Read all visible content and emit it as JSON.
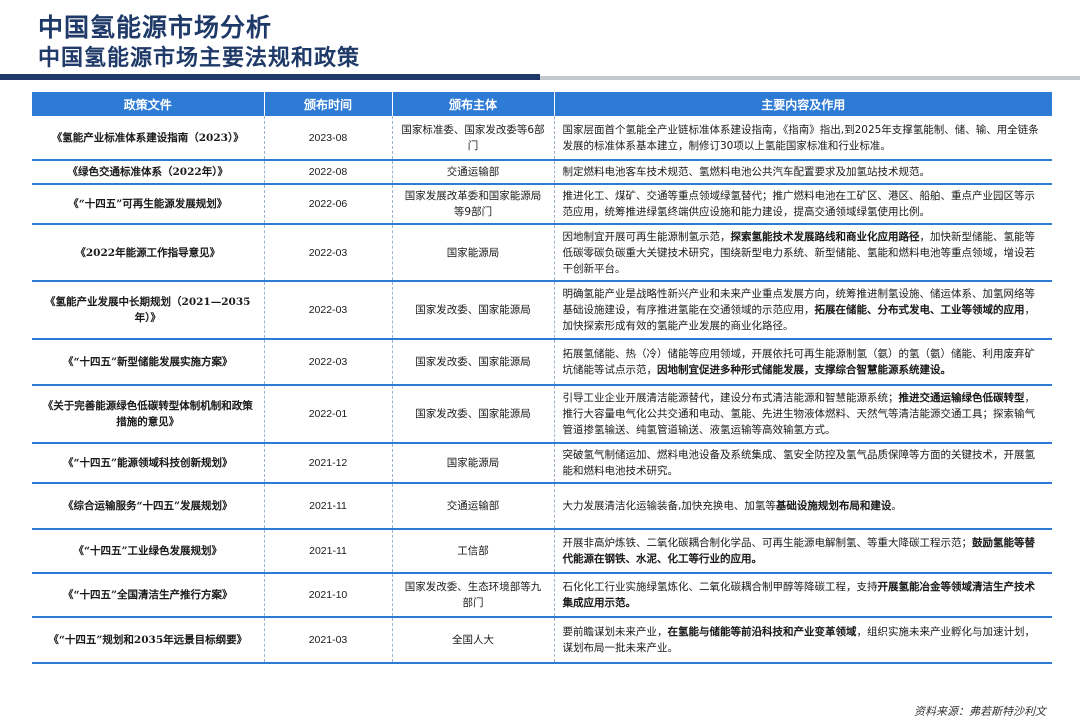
{
  "header": {
    "title": "中国氢能源市场分析",
    "subtitle": "中国氢能源市场主要法规和政策"
  },
  "table": {
    "columns": [
      "政策文件",
      "颁布时间",
      "颁布主体",
      "主要内容及作用"
    ],
    "rows": [
      {
        "document": "《氢能产业标准体系建设指南（2023）》",
        "date": "2023-08",
        "issuer": "国家标准委、国家发改委等6部门",
        "content": [
          {
            "text": "国家层面首个氢能全产业链标准体系建设指南，《指南》指出,到2025年支撑氢能制、储、输、用全链条发展的标准体系基本建立，制修订30项以上氢能国家标准和行业标准。",
            "bold": false
          }
        ]
      },
      {
        "document": "《绿色交通标准体系（2022年）》",
        "date": "2022-08",
        "issuer": "交通运输部",
        "content": [
          {
            "text": "制定燃料电池客车技术规范、氢燃料电池公共汽车配置要求及加氢站技术规范。",
            "bold": false
          }
        ]
      },
      {
        "document": "《“十四五”可再生能源发展规划》",
        "date": "2022-06",
        "issuer": "国家发展改革委和国家能源局等9部门",
        "content": [
          {
            "text": "推进化工、煤矿、交通等重点领域绿氢替代；推广燃料电池在工矿区、港区、船舶、重点产业园区等示范应用，统筹推进绿氢终端供应设施和能力建设，提高交通领域绿氢使用比例。",
            "bold": false
          }
        ]
      },
      {
        "document": "《2022年能源工作指导意见》",
        "date": "2022-03",
        "issuer": "国家能源局",
        "content": [
          {
            "text": "因地制宜开展可再生能源制氢示范，",
            "bold": false
          },
          {
            "text": "探索氢能技术发展路线和商业化应用路径",
            "bold": true
          },
          {
            "text": "，加快新型储能、氢能等低碳零碳负碳重大关键技术研究，围绕新型电力系统、新型储能、氢能和燃料电池等重点领域，增设若干创新平台。",
            "bold": false
          }
        ]
      },
      {
        "document": "《氢能产业发展中长期规划（2021—2035年）》",
        "date": "2022-03",
        "issuer": "国家发改委、国家能源局",
        "content": [
          {
            "text": "明确氢能产业是战略性新兴产业和未来产业重点发展方向，统筹推进制氢设施、储运体系、加氢网络等基础设施建设，有序推进氢能在交通领域的示范应用，",
            "bold": false
          },
          {
            "text": "拓展在储能、分布式发电、工业等领域的应用",
            "bold": true
          },
          {
            "text": "，加快探索形成有效的氢能产业发展的商业化路径。",
            "bold": false
          }
        ]
      },
      {
        "document": "《“十四五”新型储能发展实施方案》",
        "date": "2022-03",
        "issuer": "国家发改委、国家能源局",
        "content": [
          {
            "text": "拓展氢储能、热（冷）储能等应用领域，开展依托可再生能源制氢（氨）的氢（氨）储能、利用废弃矿坑储能等试点示范，",
            "bold": false
          },
          {
            "text": "因地制宜促进多种形式储能发展，支撑综合智慧能源系统建设。",
            "bold": true
          }
        ]
      },
      {
        "document": "《关于完善能源绿色低碳转型体制机制和政策措施的意见》",
        "date": "2022-01",
        "issuer": "国家发改委、国家能源局",
        "content": [
          {
            "text": "引导工业企业开展清洁能源替代，建设分布式清洁能源和智慧能源系统；",
            "bold": false
          },
          {
            "text": "推进交通运输绿色低碳转型",
            "bold": true
          },
          {
            "text": "，推行大容量电气化公共交通和电动、氢能、先进生物液体燃料、天然气等清洁能源交通工具；探索输气管道掺氢输送、纯氢管道输送、液氢运输等高效输氢方式。",
            "bold": false
          }
        ]
      },
      {
        "document": "《“十四五”能源领域科技创新规划》",
        "date": "2021-12",
        "issuer": "国家能源局",
        "content": [
          {
            "text": "突破氢气制储运加、燃料电池设备及系统集成、氢安全防控及氢气品质保障等方面的关键技术，开展氢能和燃料电池技术研究。",
            "bold": false
          }
        ]
      },
      {
        "document": "《综合运输服务“十四五”发展规划》",
        "date": "2021-11",
        "issuer": "交通运输部",
        "content": [
          {
            "text": "大力发展清洁化运输装备,加快充换电、加氢等",
            "bold": false
          },
          {
            "text": "基础设施规划布局和建设",
            "bold": true
          },
          {
            "text": "。",
            "bold": false
          }
        ]
      },
      {
        "document": "《“十四五”工业绿色发展规划》",
        "date": "2021-11",
        "issuer": "工信部",
        "content": [
          {
            "text": "开展非高炉炼铁、二氧化碳耦合制化学品、可再生能源电解制氢、等重大降碳工程示范；",
            "bold": false
          },
          {
            "text": "鼓励氢能等替代能源在钢铁、水泥、化工等行业的应用。",
            "bold": true
          }
        ]
      },
      {
        "document": "《“十四五”全国清洁生产推行方案》",
        "date": "2021-10",
        "issuer": "国家发改委、生态环境部等九部门",
        "content": [
          {
            "text": "石化化工行业实施绿氢炼化、二氧化碳耦合制甲醇等降碳工程，支持",
            "bold": false
          },
          {
            "text": "开展氢能冶金等领域清洁生产技术集成应用示范。",
            "bold": true
          }
        ]
      },
      {
        "document": "《“十四五”规划和2035年远景目标纲要》",
        "date": "2021-03",
        "issuer": "全国人大",
        "content": [
          {
            "text": "要前瞻谋划未来产业，",
            "bold": false
          },
          {
            "text": "在氢能与储能等前沿科技和产业变革领域",
            "bold": true
          },
          {
            "text": "，组织实施未来产业孵化与加速计划，谋划布局一批未来产业。",
            "bold": false
          }
        ]
      }
    ]
  },
  "footer": {
    "source": "资料来源：弗若斯特沙利文"
  }
}
